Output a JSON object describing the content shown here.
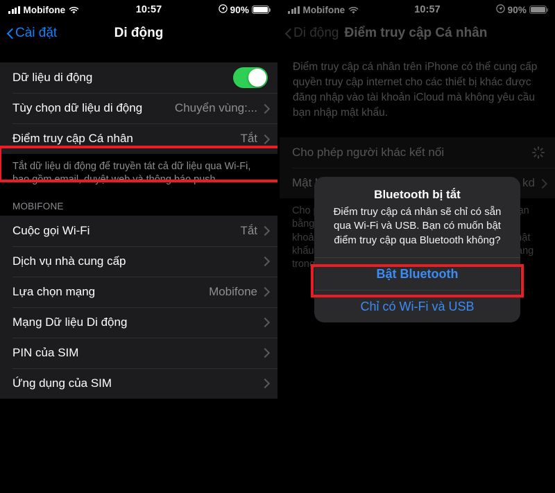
{
  "status_bar": {
    "carrier": "Mobifone",
    "signal_icon": "signal-bars-icon",
    "wifi_icon": "wifi-icon",
    "time": "10:57",
    "location_icon": "location-arrow-icon",
    "battery_percent": "90%",
    "battery_icon": "battery-icon"
  },
  "colors": {
    "accent_blue": "#0a84ff",
    "toggle_green": "#2fcf55",
    "highlight_red": "#ec1c24",
    "list_bg": "#1c1c1e",
    "secondary_text": "#8e8e93"
  },
  "left_screen": {
    "nav": {
      "back_label": "Cài đặt",
      "back_icon": "chevron-left-icon",
      "title": "Di động"
    },
    "group_one": [
      {
        "label": "Dữ liệu di động",
        "control": "toggle",
        "toggle_on": true
      },
      {
        "label": "Tùy chọn dữ liệu di động",
        "value": "Chuyển vùng:...",
        "control": "chevron"
      },
      {
        "label": "Điểm truy cập Cá nhân",
        "value": "Tắt",
        "control": "chevron",
        "highlighted": true
      }
    ],
    "footer": "Tắt dữ liệu di động để truyền tát cả dữ liệu qua Wi-Fi, bao gồm email, duyệt web và thông báo push.",
    "section_header": "MOBIFONE",
    "group_two": [
      {
        "label": "Cuộc gọi Wi-Fi",
        "value": "Tắt",
        "control": "chevron"
      },
      {
        "label": "Dịch vụ nhà cung cấp",
        "value": "",
        "control": "chevron"
      },
      {
        "label": "Lựa chọn mạng",
        "value": "Mobifone",
        "control": "chevron"
      },
      {
        "label": "Mạng Dữ liệu Di động",
        "value": "",
        "control": "chevron"
      },
      {
        "label": "PIN của SIM",
        "value": "",
        "control": "chevron"
      },
      {
        "label": "Ứng dụng của SIM",
        "value": "",
        "control": "chevron"
      }
    ]
  },
  "right_screen": {
    "nav": {
      "back_label": "Di động",
      "back_icon": "chevron-left-icon",
      "title": "Điểm truy cập Cá nhân"
    },
    "description": "Điểm truy cập cá nhân trên iPhone có thể cung cấp quyền truy cập internet cho các thiết bị khác được đăng nhập vào tài khoản iCloud mà không yêu cầu bạn nhập mật khẩu.",
    "rows": [
      {
        "label": "Cho phép người khác kết nối",
        "control": "spinner"
      },
      {
        "label": "Mật khẩu Wi-Fi",
        "value": "kd",
        "control": "chevron"
      }
    ],
    "footer": "Cho phép những người khác tham gia mạng của bạn bằng cách đăng nhập vào iPhone của bạn hoặc tài khoản iCloud “Administrator” mà không cần nhập mật khẩu điểm truy cập cá nhân. Họ có thể tham gia mạng trong khi được mời.",
    "alert": {
      "title": "Bluetooth bị tắt",
      "message": "Điểm truy cập cá nhân sẽ chỉ có sẵn qua Wi-Fi và USB. Bạn có muốn bật điểm truy cập qua Bluetooth không?",
      "primary_button": "Bật Bluetooth",
      "secondary_button": "Chỉ có Wi-Fi và USB",
      "primary_highlighted": true
    }
  }
}
